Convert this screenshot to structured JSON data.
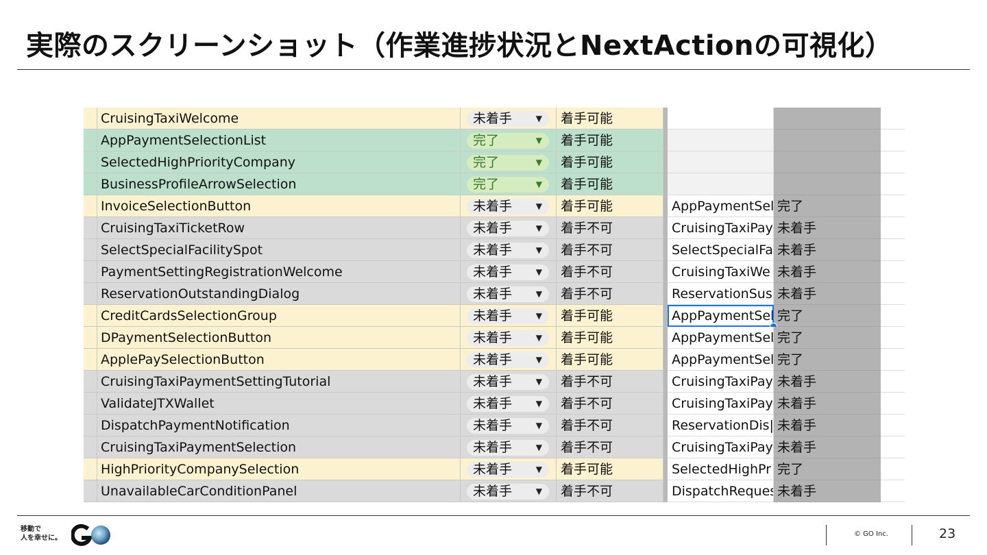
{
  "title": "実際のスクリーンショット（作業進捗状況とNextActionの可視化）",
  "sheet": {
    "rows": [
      {
        "name": "CruisingTaxiWelcome",
        "status": "未着手",
        "availability": "着手可能",
        "dependency": "",
        "dependency_status": "",
        "color": "yellow"
      },
      {
        "name": "AppPaymentSelectionList",
        "status": "完了",
        "availability": "着手可能",
        "dependency": "",
        "dependency_status": "",
        "color": "green"
      },
      {
        "name": "SelectedHighPriorityCompany",
        "status": "完了",
        "availability": "着手可能",
        "dependency": "",
        "dependency_status": "",
        "color": "green"
      },
      {
        "name": "BusinessProfileArrowSelection",
        "status": "完了",
        "availability": "着手可能",
        "dependency": "",
        "dependency_status": "",
        "color": "green"
      },
      {
        "name": "InvoiceSelectionButton",
        "status": "未着手",
        "availability": "着手可能",
        "dependency": "AppPaymentSel",
        "dependency_status": "完了",
        "color": "yellow"
      },
      {
        "name": "CruisingTaxiTicketRow",
        "status": "未着手",
        "availability": "着手不可",
        "dependency": "CruisingTaxiPay",
        "dependency_status": "未着手",
        "color": "gray"
      },
      {
        "name": "SelectSpecialFacilitySpot",
        "status": "未着手",
        "availability": "着手不可",
        "dependency": "SelectSpecialFa",
        "dependency_status": "未着手",
        "color": "gray"
      },
      {
        "name": "PaymentSettingRegistrationWelcome",
        "status": "未着手",
        "availability": "着手不可",
        "dependency": "CruisingTaxiWe",
        "dependency_status": "未着手",
        "color": "gray"
      },
      {
        "name": "ReservationOutstandingDialog",
        "status": "未着手",
        "availability": "着手不可",
        "dependency": "ReservationSus",
        "dependency_status": "未着手",
        "color": "gray"
      },
      {
        "name": "CreditCardsSelectionGroup",
        "status": "未着手",
        "availability": "着手可能",
        "dependency": "AppPaymentSel",
        "dependency_status": "完了",
        "color": "yellow"
      },
      {
        "name": "DPaymentSelectionButton",
        "status": "未着手",
        "availability": "着手可能",
        "dependency": "AppPaymentSel",
        "dependency_status": "完了",
        "color": "yellow"
      },
      {
        "name": "ApplePaySelectionButton",
        "status": "未着手",
        "availability": "着手可能",
        "dependency": "AppPaymentSel",
        "dependency_status": "完了",
        "color": "yellow"
      },
      {
        "name": "CruisingTaxiPaymentSettingTutorial",
        "status": "未着手",
        "availability": "着手不可",
        "dependency": "CruisingTaxiPay",
        "dependency_status": "未着手",
        "color": "gray"
      },
      {
        "name": "ValidateJTXWallet",
        "status": "未着手",
        "availability": "着手不可",
        "dependency": "CruisingTaxiPay",
        "dependency_status": "未着手",
        "color": "gray"
      },
      {
        "name": "DispatchPaymentNotification",
        "status": "未着手",
        "availability": "着手不可",
        "dependency": "ReservationDis|",
        "dependency_status": "未着手",
        "color": "gray"
      },
      {
        "name": "CruisingTaxiPaymentSelection",
        "status": "未着手",
        "availability": "着手不可",
        "dependency": "CruisingTaxiPay",
        "dependency_status": "未着手",
        "color": "gray"
      },
      {
        "name": "HighPriorityCompanySelection",
        "status": "未着手",
        "availability": "着手可能",
        "dependency": "SelectedHighPr",
        "dependency_status": "完了",
        "color": "yellow"
      },
      {
        "name": "UnavailableCarConditionPanel",
        "status": "未着手",
        "availability": "着手不可",
        "dependency": "DispatchReques",
        "dependency_status": "未着手",
        "color": "gray"
      }
    ],
    "selected_row": 9,
    "dropdown_icon": "triangle-down-icon"
  },
  "footer": {
    "logo_line1": "移動で",
    "logo_line2": "人を幸せに。",
    "logo_mark": "GO",
    "copyright": "© GO Inc.",
    "page_number": "23"
  },
  "colors": {
    "yellow_row": "#fdf2cf",
    "green_row": "#bde0cc",
    "gray_row": "#dadada",
    "done_chip": "#d4ecbf",
    "selection": "#1a73e8"
  }
}
